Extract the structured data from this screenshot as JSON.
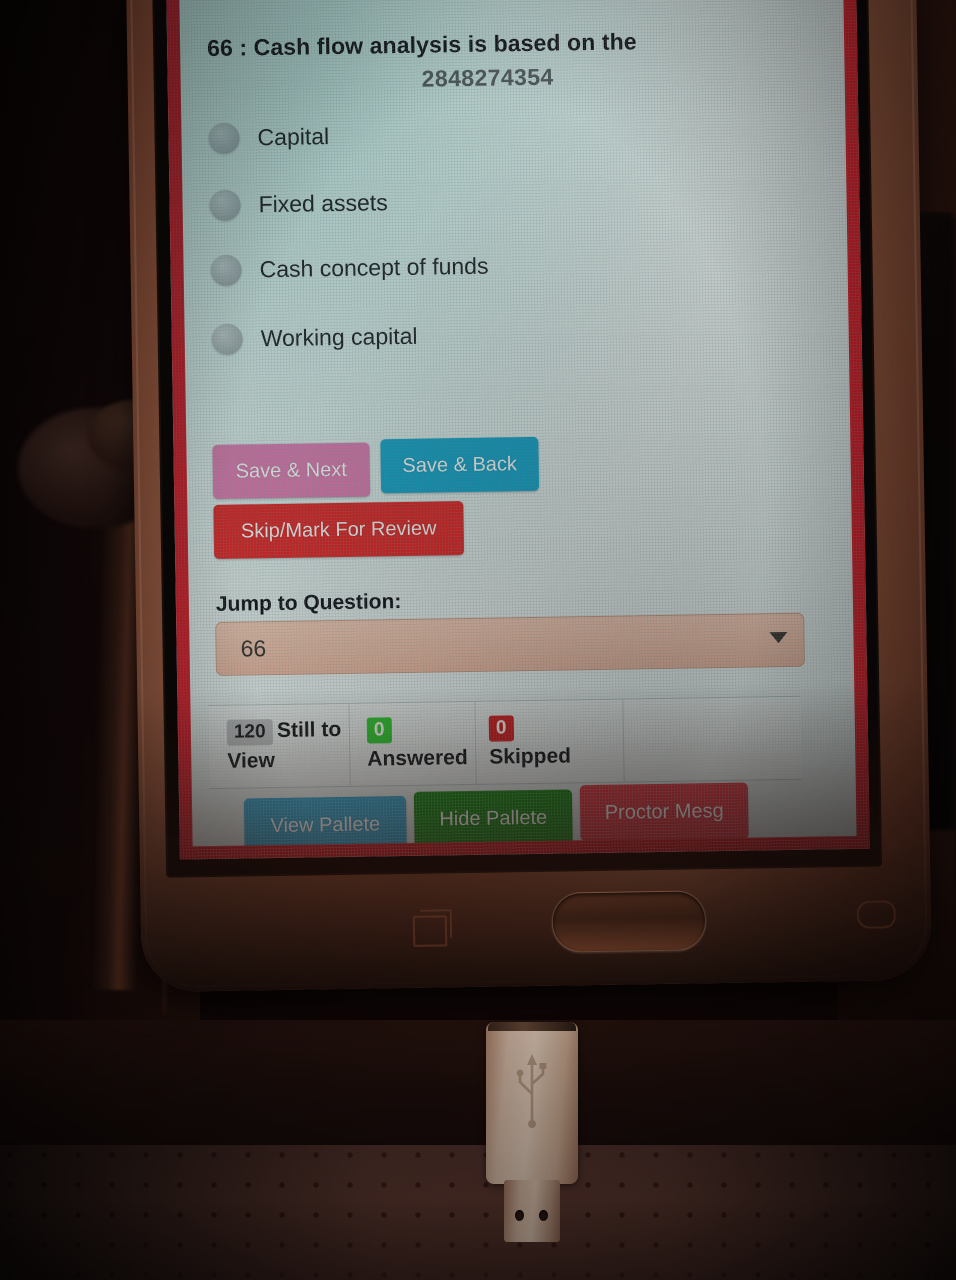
{
  "exam": {
    "question": {
      "number_prefix": "66 : ",
      "text": "Cash flow analysis is based on the",
      "full_title": "66 : Cash flow analysis is based on the",
      "sub_number": "2848274354"
    },
    "options": [
      {
        "label": "Capital",
        "selected": false
      },
      {
        "label": "Fixed assets",
        "selected": false
      },
      {
        "label": "Cash concept of funds",
        "selected": false
      },
      {
        "label": "Working capital",
        "selected": false
      }
    ],
    "actions": {
      "save_next": "Save & Next",
      "save_back": "Save & Back",
      "skip_mark": "Skip/Mark For Review"
    },
    "jump": {
      "label": "Jump to Question:",
      "value": "66",
      "caret": "chevron-down-icon"
    },
    "stats": [
      {
        "count": "120",
        "label_line1": "Still to",
        "label_line2": "View",
        "color": "#b9bfc2"
      },
      {
        "count": "0",
        "label_line1": "",
        "label_line2": "Answered",
        "color": "#2ecc2e"
      },
      {
        "count": "0",
        "label_line1": "",
        "label_line2": "Skipped",
        "color": "#d41f1f"
      }
    ],
    "footer": {
      "view_pallete": "View Pallete",
      "hide_pallete": "Hide Pallete",
      "proctor_mesg": "Proctor Mesg"
    },
    "colors": {
      "page_border": "#d81f2a",
      "save_next": "#e17fb4",
      "save_back": "#19a8cf",
      "skip_mark": "#e22b2b",
      "view_pallete": "#35a8d4",
      "hide_pallete": "#1a8a1a",
      "proctor_mesg": "#e03a47",
      "jump_field": "#e8bfa9",
      "screen_bg": "#dfeceb"
    }
  },
  "device": {
    "home_button": "home-button",
    "recents_button": "recents-icon",
    "back_button": "back-icon"
  },
  "cable": {
    "connector": "usb-connector",
    "logo": "usb-trident-icon"
  }
}
